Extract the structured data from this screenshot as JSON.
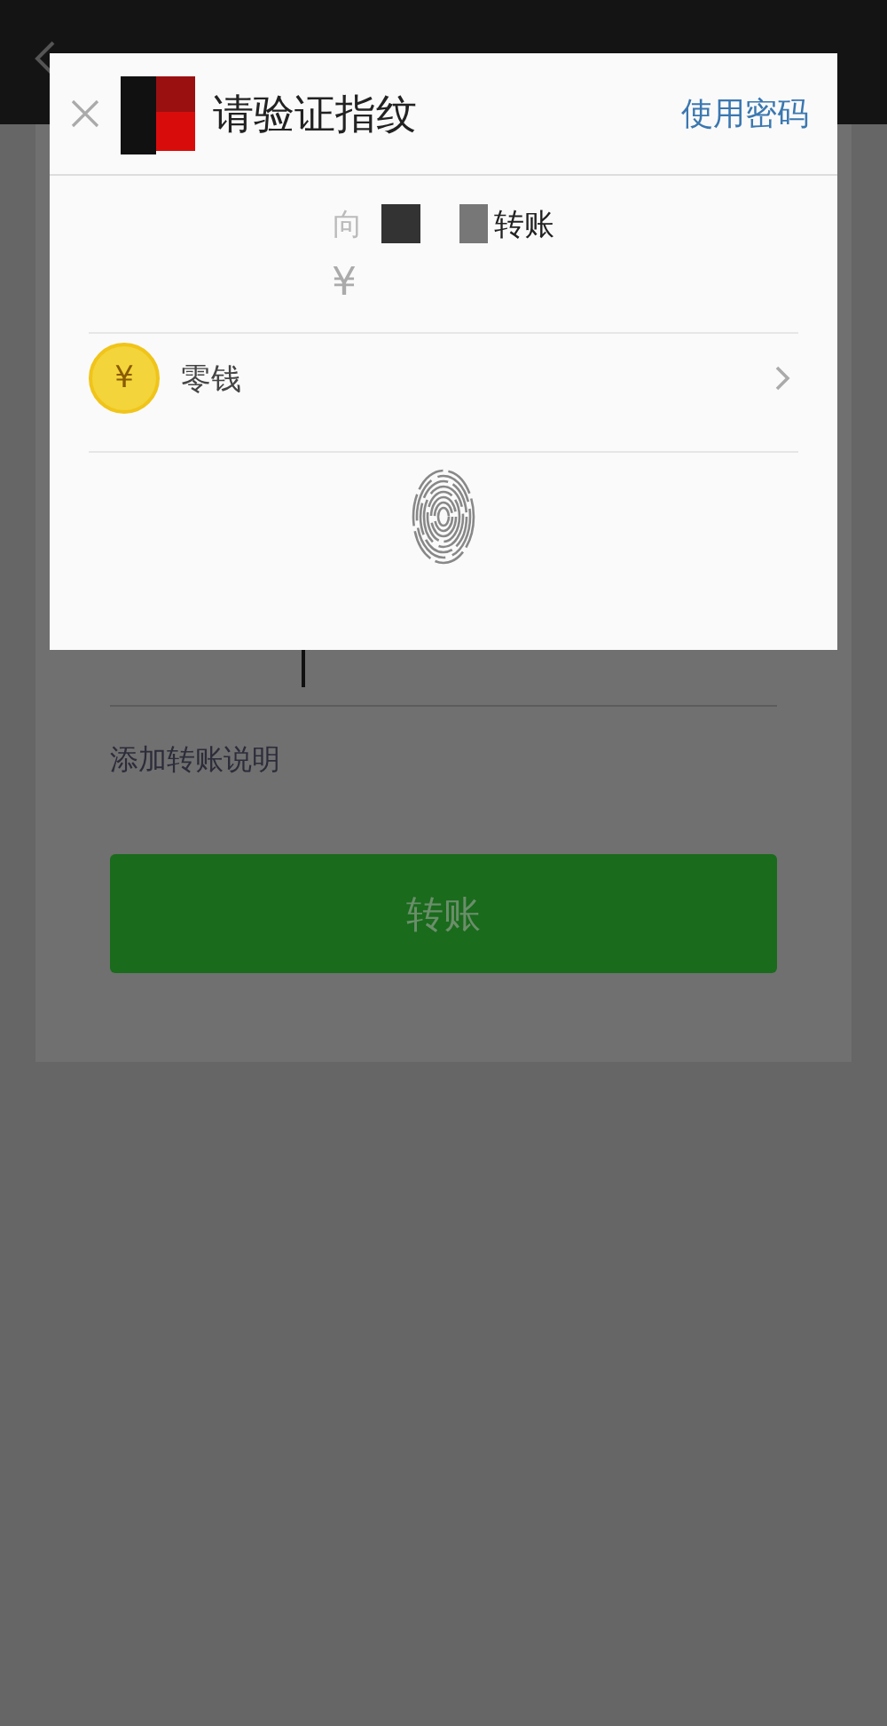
{
  "page": {
    "note_link": "添加转账说明",
    "submit_button": "转账"
  },
  "dialog": {
    "title": "请验证指纹",
    "alt_action": "使用密码",
    "recipient_prefix": "向",
    "recipient_suffix": "转账",
    "currency": "¥",
    "payment_method": {
      "label": "零钱",
      "coin_symbol": "¥"
    }
  }
}
